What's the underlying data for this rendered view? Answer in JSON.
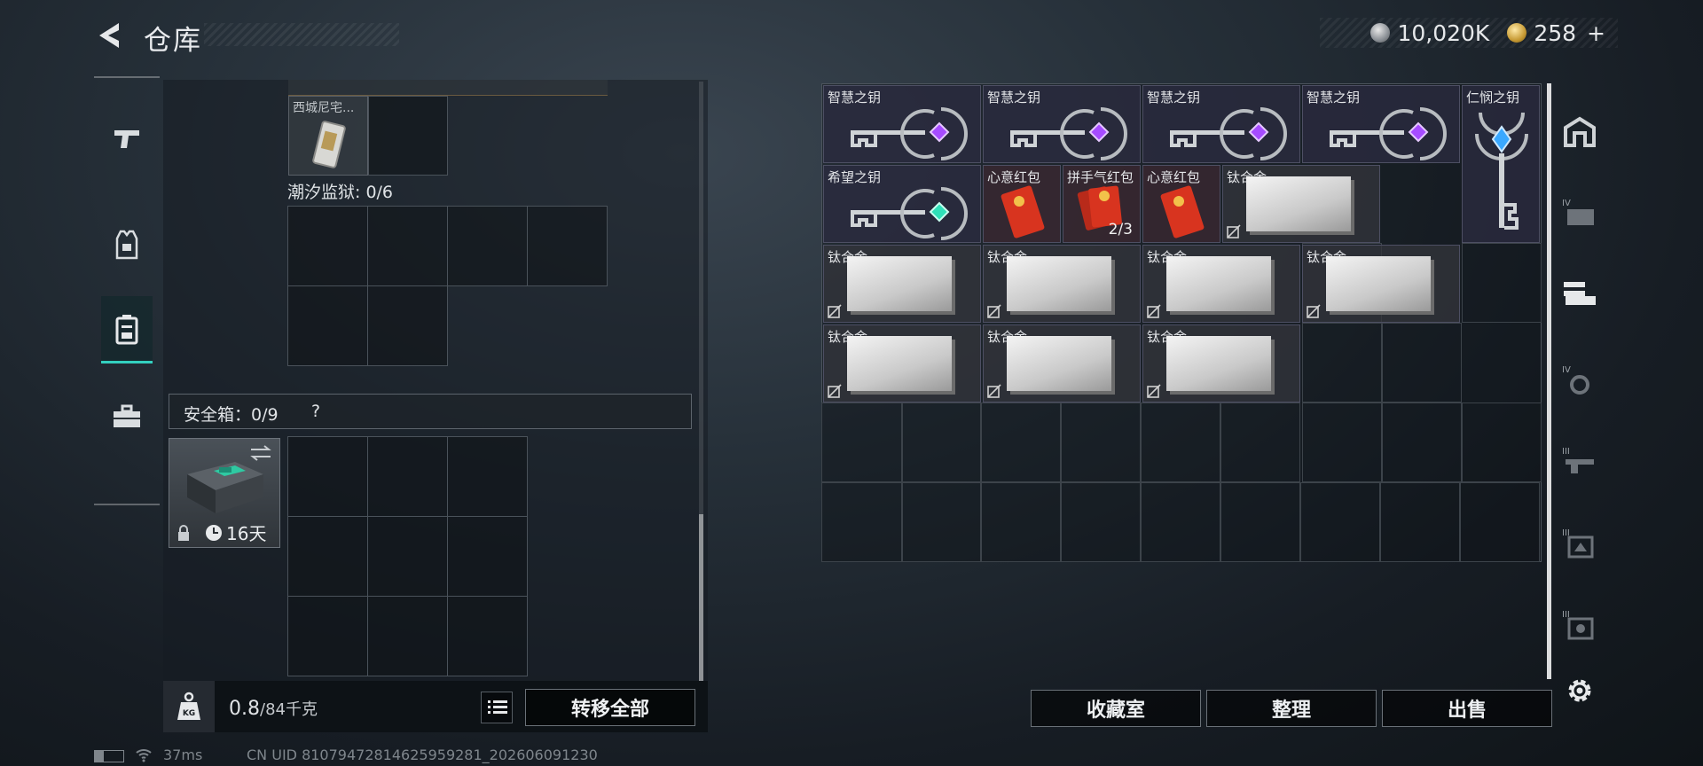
{
  "header": {
    "title": "仓库",
    "back_icon": "back-arrow-icon"
  },
  "currency": {
    "silver_value": "10,020K",
    "gold_value": "258",
    "add_label": "+"
  },
  "left_tabs": [
    {
      "icon": "pistol-icon",
      "active": false
    },
    {
      "icon": "armor-vest-icon",
      "active": false
    },
    {
      "icon": "backpack-icon",
      "active": true
    },
    {
      "icon": "briefcase-icon",
      "active": false
    }
  ],
  "left_panel": {
    "item_card_name": "西城尼宅...",
    "prison_label": "潮汐监狱: 0/6",
    "safebox_label": "安全箱：0/9",
    "safebox_help": "?",
    "safebox_timer": "16天"
  },
  "bottom_bar": {
    "weight_value": "0.8",
    "weight_max": "/84千克",
    "transfer_all": "转移全部"
  },
  "right_items": {
    "row1": [
      {
        "name": "智慧之钥",
        "gem": "#a64bff"
      },
      {
        "name": "智慧之钥",
        "gem": "#a64bff"
      },
      {
        "name": "智慧之钥",
        "gem": "#a64bff"
      },
      {
        "name": "智慧之钥",
        "gem": "#a64bff"
      },
      {
        "name": "仁悯之钥",
        "gem": "#3aa8ff"
      }
    ],
    "row2": [
      {
        "name": "希望之钥",
        "gem": "#2fe0b8"
      },
      {
        "name": "心意红包"
      },
      {
        "name": "拼手气红包",
        "count": "2/3"
      },
      {
        "name": "心意红包"
      },
      {
        "name": "钛合金"
      }
    ],
    "alloy_name": "钛合金"
  },
  "actions": {
    "collection": "收藏室",
    "sort": "整理",
    "sell": "出售"
  },
  "right_tabs": [
    "vault-icon",
    "tier-4-case-icon",
    "weapon-rack-icon",
    "tier-4-weapon-icon",
    "tier-3-rifle-icon",
    "tier-3-case-icon",
    "tier-3-box-icon"
  ],
  "status_bar": {
    "ping": "37ms",
    "uid": "CN UID 8107947281462595928​1_202606091230"
  }
}
